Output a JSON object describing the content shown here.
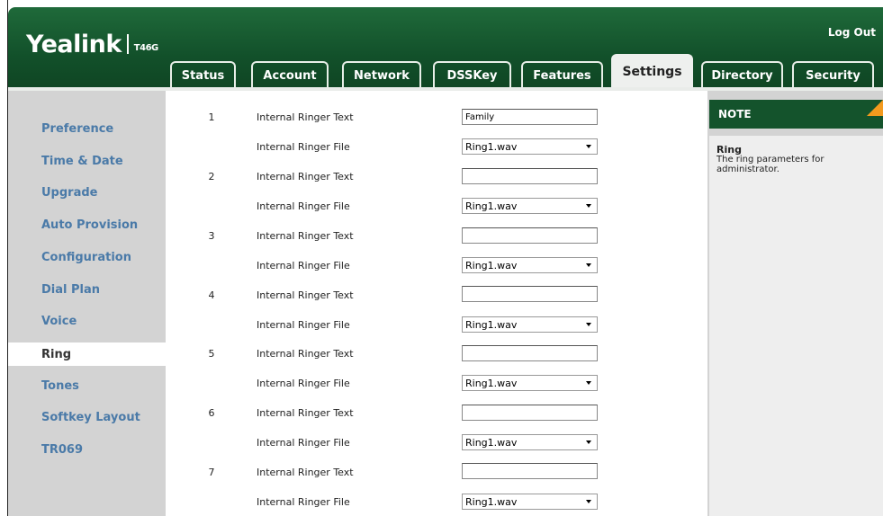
{
  "header": {
    "brand": "Yealink",
    "model": "T46G",
    "logout_label": "Log Out"
  },
  "tabs": [
    {
      "label": "Status"
    },
    {
      "label": "Account"
    },
    {
      "label": "Network"
    },
    {
      "label": "DSSKey"
    },
    {
      "label": "Features"
    },
    {
      "label": "Settings",
      "active": true
    },
    {
      "label": "Directory"
    },
    {
      "label": "Security"
    }
  ],
  "sidebar": {
    "items": [
      {
        "label": "Preference"
      },
      {
        "label": "Time & Date"
      },
      {
        "label": "Upgrade"
      },
      {
        "label": "Auto Provision"
      },
      {
        "label": "Configuration"
      },
      {
        "label": "Dial Plan"
      },
      {
        "label": "Voice"
      },
      {
        "label": "Ring",
        "active": true
      },
      {
        "label": "Tones"
      },
      {
        "label": "Softkey Layout"
      },
      {
        "label": "TR069"
      }
    ]
  },
  "ringers": [
    {
      "num": "1",
      "text_label": "Internal Ringer Text",
      "text_value": "Family",
      "file_label": "Internal Ringer File",
      "file_value": "Ring1.wav"
    },
    {
      "num": "2",
      "text_label": "Internal Ringer Text",
      "text_value": "",
      "file_label": "Internal Ringer File",
      "file_value": "Ring1.wav"
    },
    {
      "num": "3",
      "text_label": "Internal Ringer Text",
      "text_value": "",
      "file_label": "Internal Ringer File",
      "file_value": "Ring1.wav"
    },
    {
      "num": "4",
      "text_label": "Internal Ringer Text",
      "text_value": "",
      "file_label": "Internal Ringer File",
      "file_value": "Ring1.wav"
    },
    {
      "num": "5",
      "text_label": "Internal Ringer Text",
      "text_value": "",
      "file_label": "Internal Ringer File",
      "file_value": "Ring1.wav"
    },
    {
      "num": "6",
      "text_label": "Internal Ringer Text",
      "text_value": "",
      "file_label": "Internal Ringer File",
      "file_value": "Ring1.wav"
    },
    {
      "num": "7",
      "text_label": "Internal Ringer Text",
      "text_value": "",
      "file_label": "Internal Ringer File",
      "file_value": "Ring1.wav"
    }
  ],
  "note": {
    "heading": "NOTE",
    "title": "Ring",
    "body": "The ring parameters for administrator."
  },
  "colors": {
    "header_green": "#14532c",
    "sidebar_link": "#4a7aa8",
    "note_corner": "#f39a1e"
  }
}
